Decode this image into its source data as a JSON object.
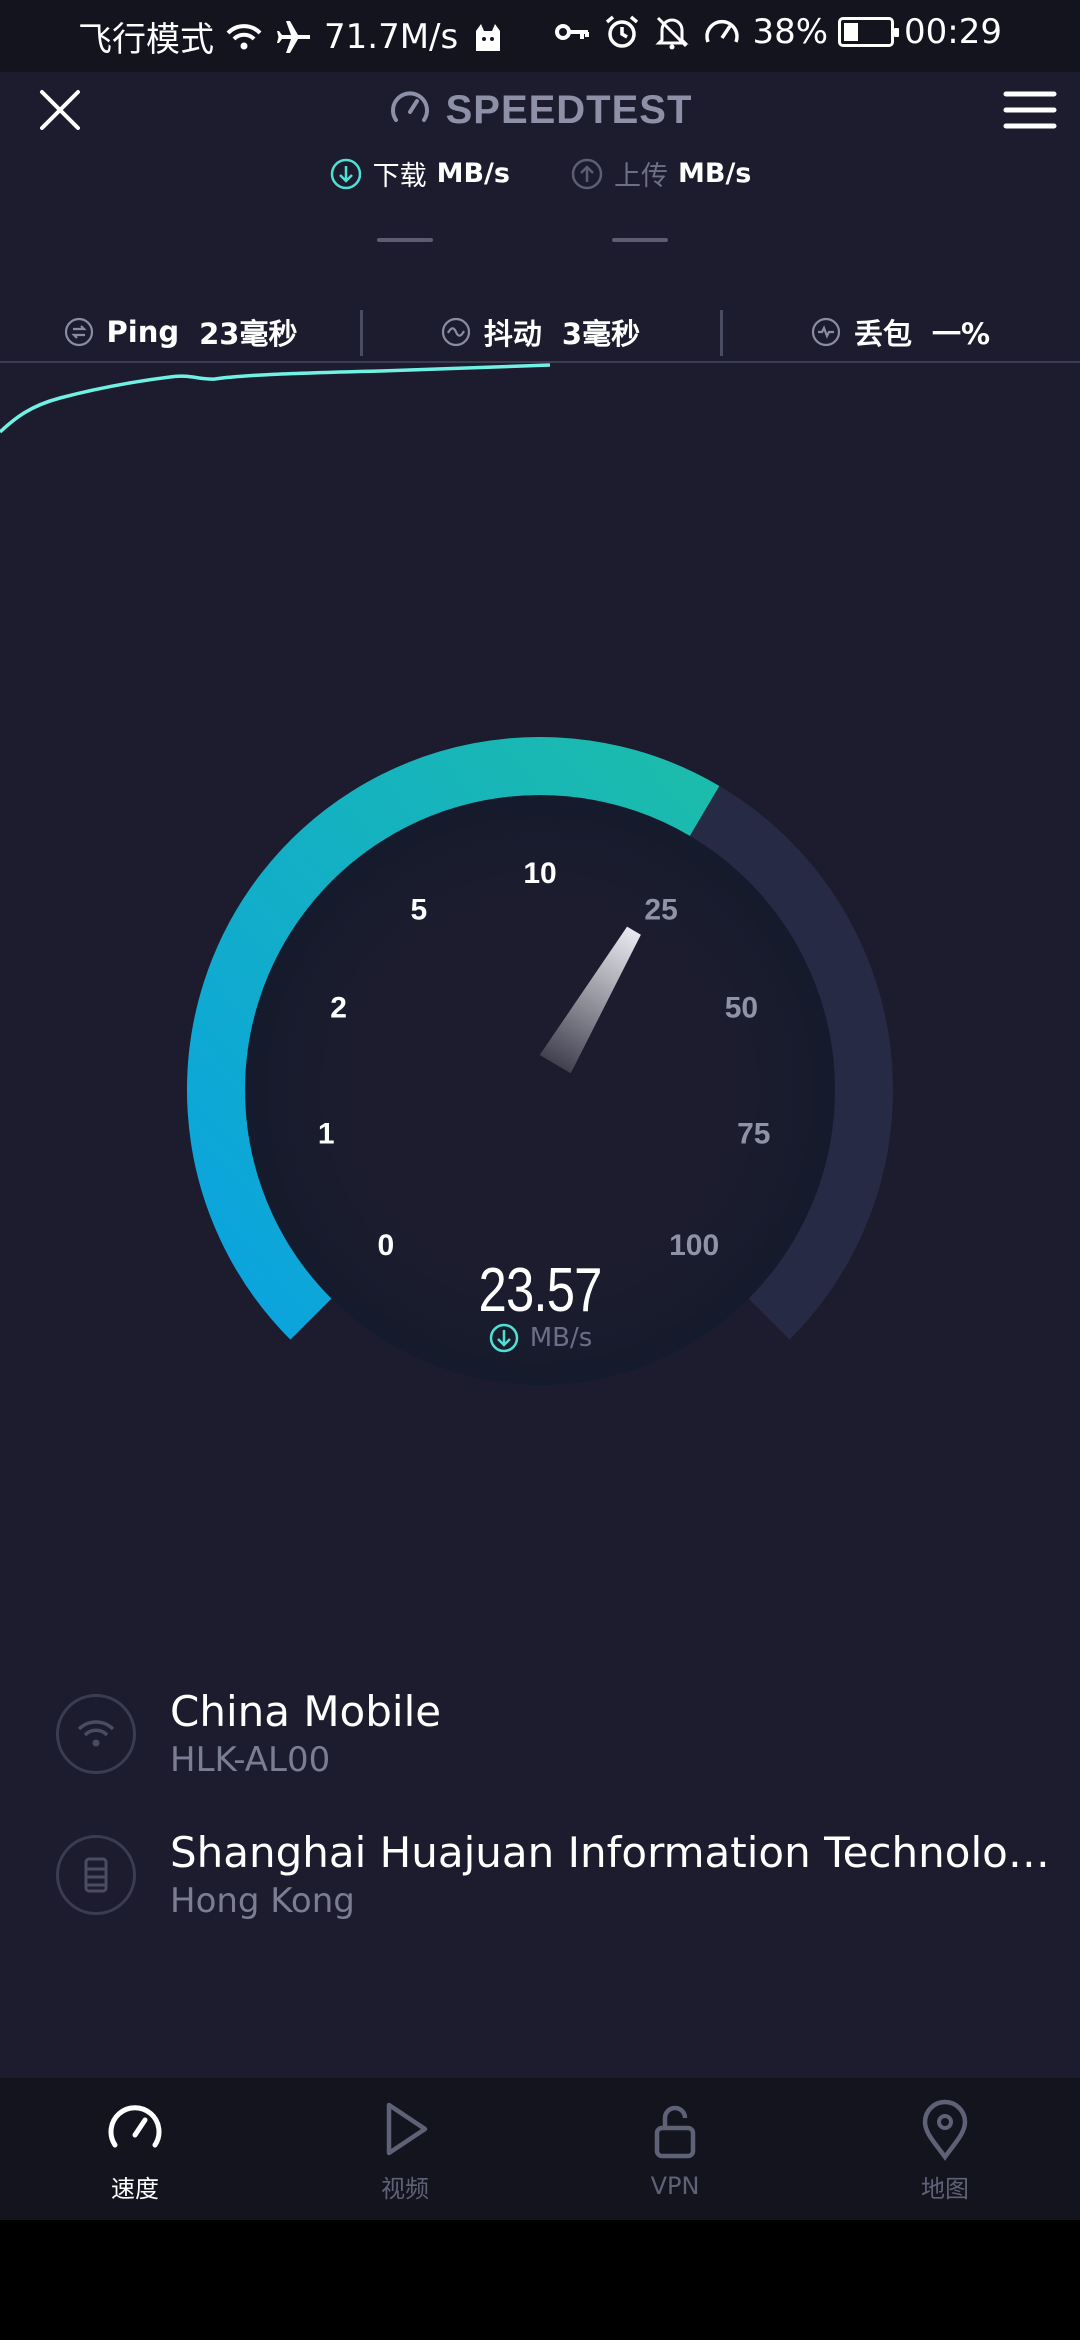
{
  "status_bar": {
    "mode": "飞行模式",
    "net_speed": "71.7M/s",
    "battery": "38%",
    "time": "00:29",
    "icons": [
      "wifi-icon",
      "airplane-icon",
      "cat-icon",
      "key-icon",
      "alarm-icon",
      "mute-icon",
      "speed-icon",
      "battery-icon"
    ]
  },
  "header": {
    "title": "SPEEDTEST",
    "download_label": "下载",
    "upload_label": "上传",
    "unit": "MB/s"
  },
  "metrics": {
    "ping_label": "Ping",
    "ping_value": "23毫秒",
    "jitter_label": "抖动",
    "jitter_value": "3毫秒",
    "loss_label": "丢包",
    "loss_value": "一%"
  },
  "gauge": {
    "ticks": [
      {
        "label": "0",
        "value": 0
      },
      {
        "label": "1",
        "value": 1
      },
      {
        "label": "2",
        "value": 2
      },
      {
        "label": "5",
        "value": 5
      },
      {
        "label": "10",
        "value": 10
      },
      {
        "label": "25",
        "value": 25
      },
      {
        "label": "50",
        "value": 50
      },
      {
        "label": "75",
        "value": 75
      },
      {
        "label": "100",
        "value": 100
      }
    ],
    "current_value": 23.57,
    "reading_text": "23.57",
    "unit": "MB/s",
    "colors": {
      "start": "#0aa3e0",
      "end": "#1cbcab",
      "track": "#262a44"
    }
  },
  "connection": {
    "provider": "China Mobile",
    "device": "HLK-AL00",
    "server": "Shanghai Huajuan Information Technolog...",
    "location": "Hong Kong"
  },
  "bottom_nav": {
    "items": [
      {
        "label": "速度",
        "icon": "speedometer-icon",
        "active": true
      },
      {
        "label": "视频",
        "icon": "play-icon",
        "active": false
      },
      {
        "label": "VPN",
        "icon": "lock-icon",
        "active": false
      },
      {
        "label": "地图",
        "icon": "map-pin-icon",
        "active": false
      }
    ]
  }
}
